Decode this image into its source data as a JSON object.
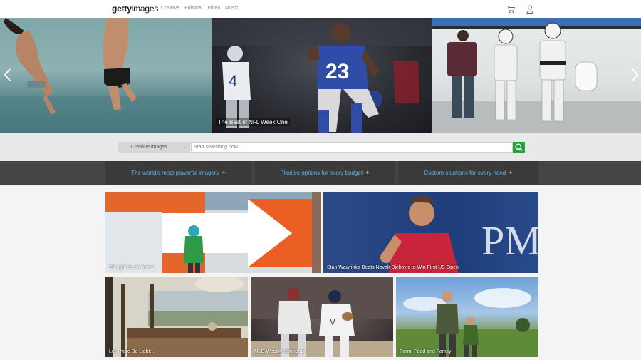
{
  "header": {
    "logo_bold": "getty",
    "logo_rest": "images",
    "nav": [
      "Creative",
      "Editorial",
      "Video",
      "Music"
    ]
  },
  "icons": {
    "cart": "cart-icon",
    "user": "user-icon",
    "search": "search-icon",
    "arrow_left": "chevron-left-icon",
    "arrow_right": "chevron-right-icon"
  },
  "hero": {
    "caption": "The Best of NFL Week One"
  },
  "search": {
    "scope": "Creative images",
    "placeholder": "Start searching now ..."
  },
  "props": [
    {
      "label": "The world's most powerful imagery",
      "plus": "+"
    },
    {
      "label": "Flexible options for every budget",
      "plus": "+"
    },
    {
      "label": "Custom solutions for every need",
      "plus": "+"
    }
  ],
  "tiles": [
    {
      "caption": "Straight as an Arrow"
    },
    {
      "caption": "Stan Wawrinka Beats Novak Djekovic to Win First US Open"
    },
    {
      "caption": "Let There Be Light..."
    },
    {
      "caption": "MLB Weekly Roundup"
    },
    {
      "caption": "Farm, Food and Family"
    }
  ],
  "colors": {
    "accent_blue": "#5db4ea",
    "search_green": "#22a63a",
    "band_dark": "#444444"
  }
}
